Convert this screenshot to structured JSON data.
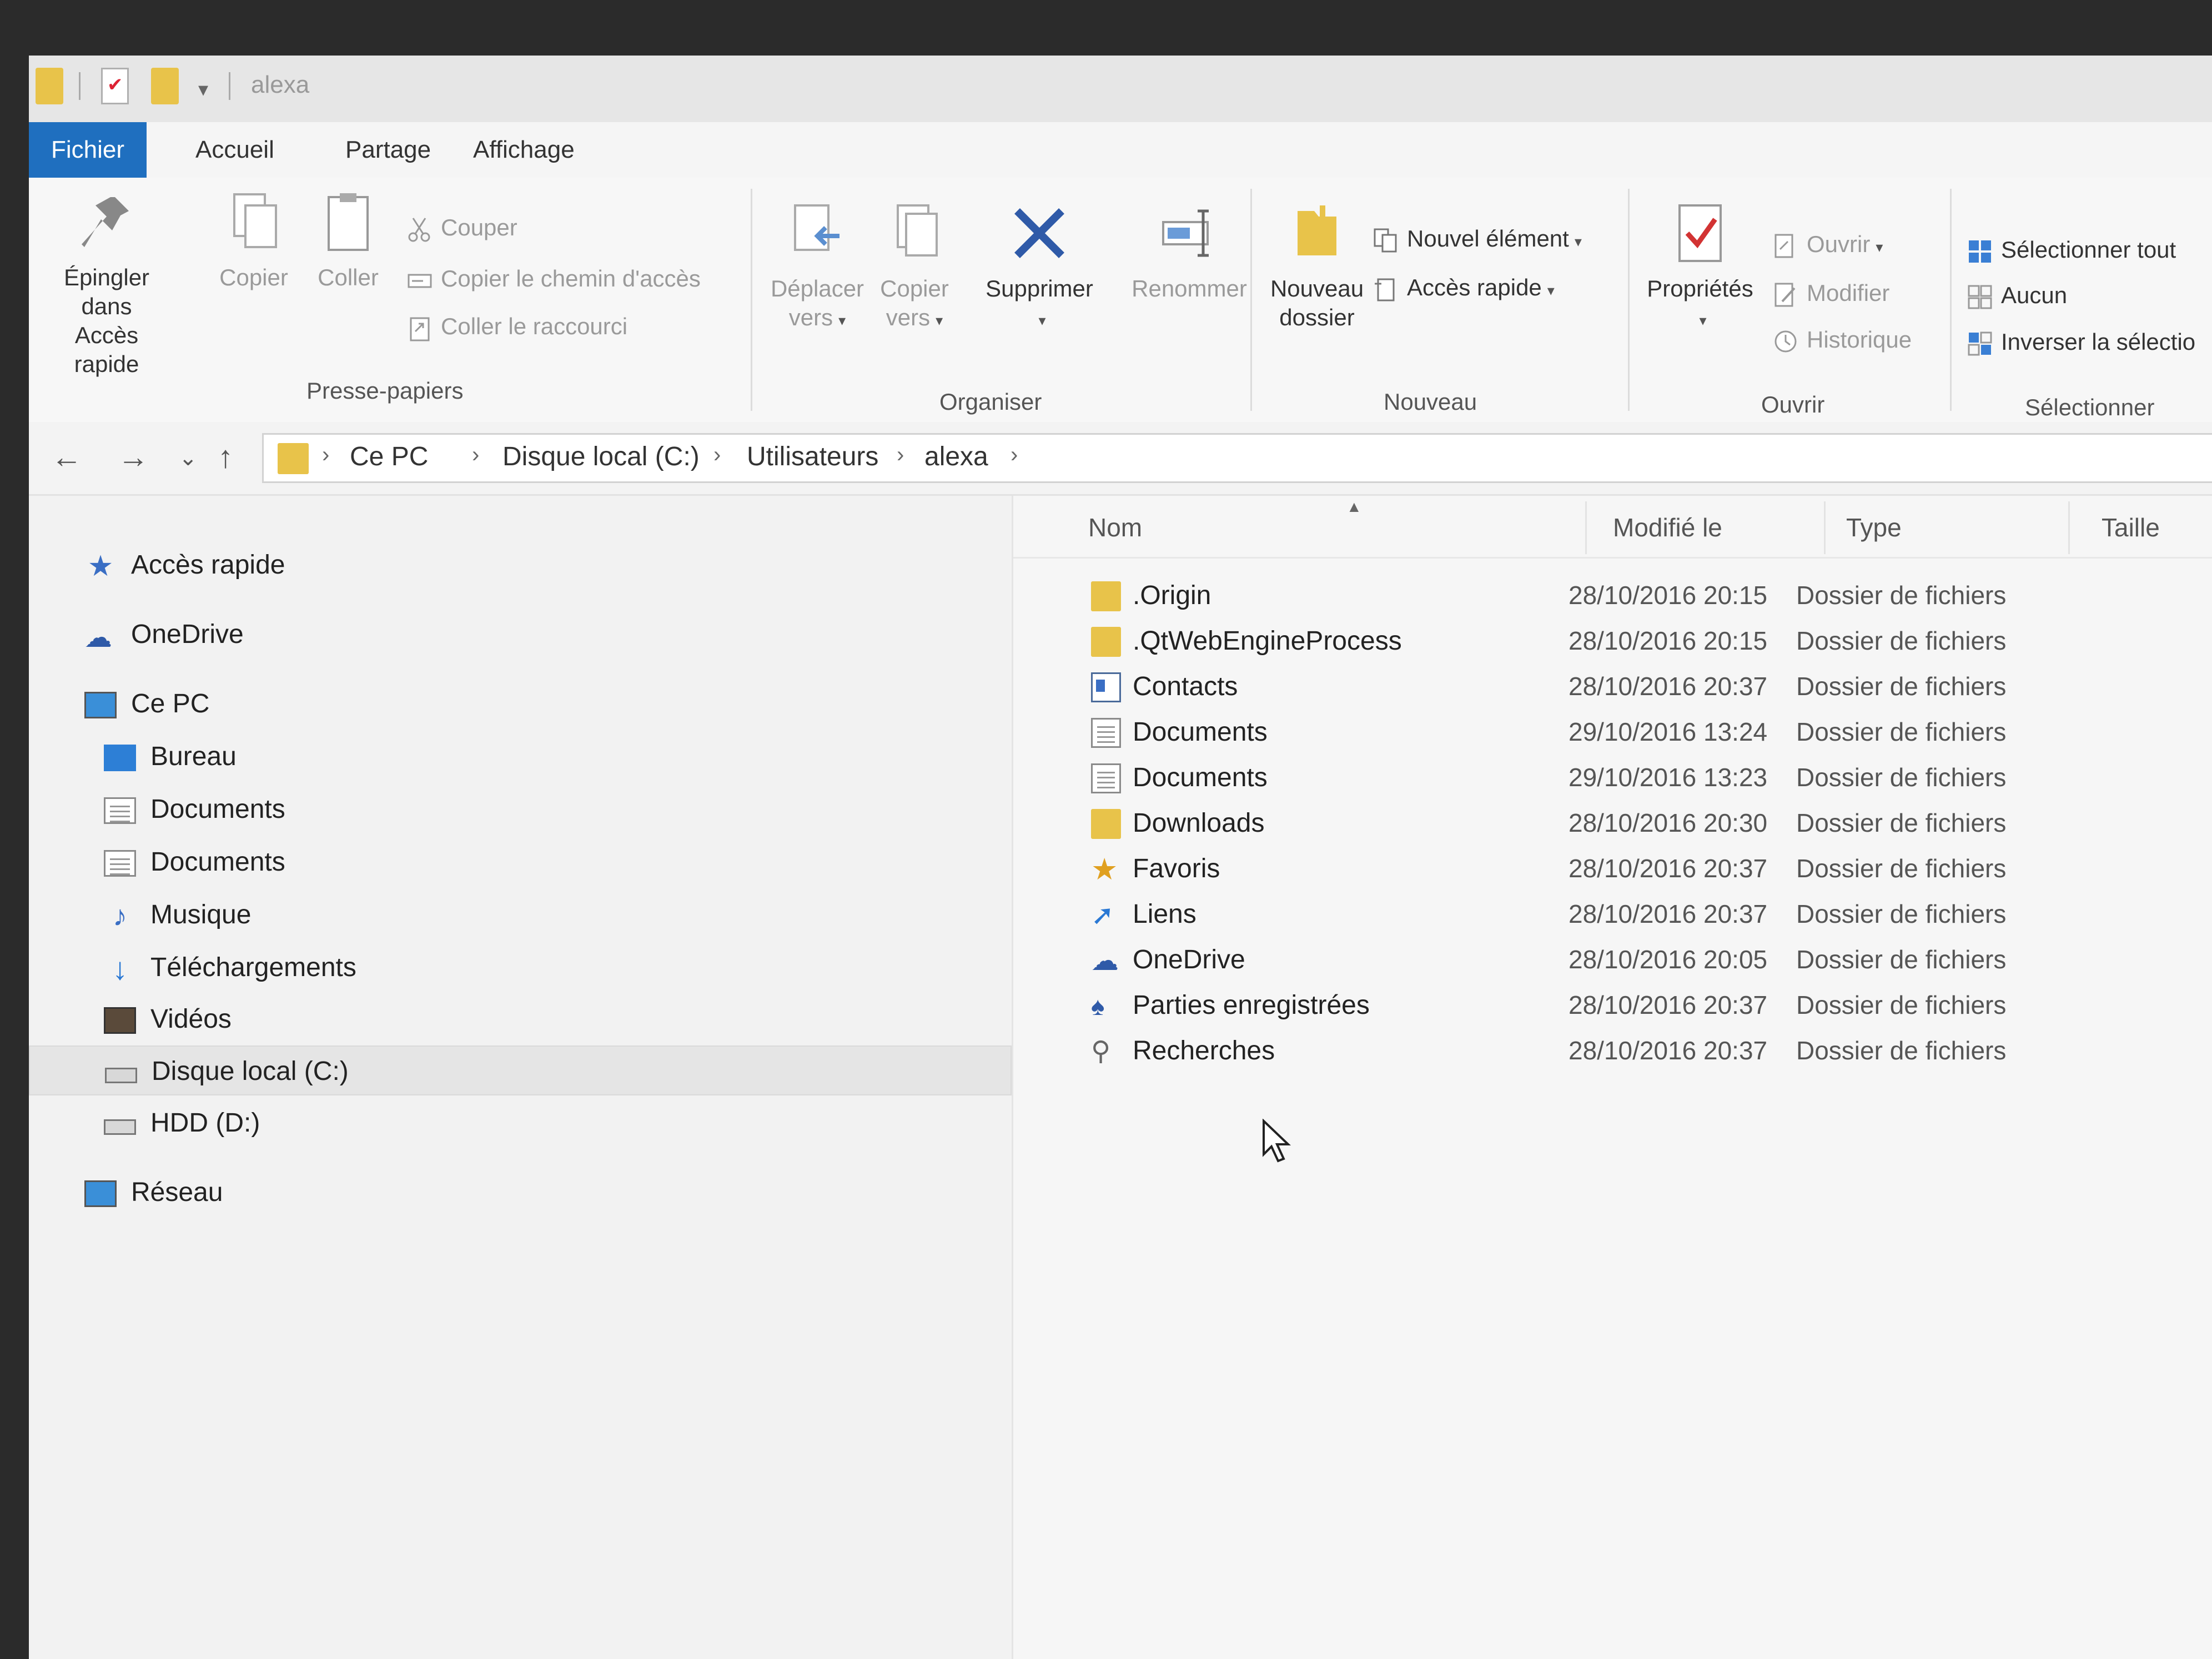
{
  "window": {
    "title": "alexa"
  },
  "ribbon_tabs": [
    {
      "label": "Fichier"
    },
    {
      "label": "Accueil"
    },
    {
      "label": "Partage"
    },
    {
      "label": "Affichage"
    }
  ],
  "ribbon": {
    "clipboard": {
      "pin_label_1": "Épingler dans",
      "pin_label_2": "Accès rapide",
      "copy_label": "Copier",
      "paste_label": "Coller",
      "cut_label": "Couper",
      "copy_path_label": "Copier le chemin d'accès",
      "paste_shortcut_label": "Coller le raccourci",
      "group_label": "Presse-papiers"
    },
    "organize": {
      "move_label_1": "Déplacer",
      "move_label_2": "vers",
      "copyto_label_1": "Copier",
      "copyto_label_2": "vers",
      "delete_label": "Supprimer",
      "rename_label": "Renommer",
      "group_label": "Organiser"
    },
    "new": {
      "new_folder_label_1": "Nouveau",
      "new_folder_label_2": "dossier",
      "new_item_label": "Nouvel élément",
      "easy_access_label": "Accès rapide",
      "group_label": "Nouveau"
    },
    "open": {
      "properties_label": "Propriétés",
      "open_label": "Ouvrir",
      "edit_label": "Modifier",
      "history_label": "Historique",
      "group_label": "Ouvrir"
    },
    "select": {
      "select_all_label": "Sélectionner tout",
      "select_none_label": "Aucun",
      "invert_label": "Inverser la sélectio",
      "group_label": "Sélectionner"
    }
  },
  "address": {
    "crumbs": [
      "Ce PC",
      "Disque local (C:)",
      "Utilisateurs",
      "alexa"
    ]
  },
  "nav": {
    "items": [
      {
        "label": "Accès rapide",
        "icon": "star-icon"
      },
      {
        "label": "OneDrive",
        "icon": "cloud-icon"
      },
      {
        "label": "Ce PC",
        "icon": "computer-icon"
      },
      {
        "label": "Bureau",
        "icon": "desktop-icon"
      },
      {
        "label": "Documents",
        "icon": "documents-icon"
      },
      {
        "label": "Documents",
        "icon": "pictures-icon"
      },
      {
        "label": "Musique",
        "icon": "music-icon"
      },
      {
        "label": "Téléchargements",
        "icon": "download-icon"
      },
      {
        "label": "Vidéos",
        "icon": "video-icon"
      },
      {
        "label": "Disque local (C:)",
        "icon": "drive-icon"
      },
      {
        "label": "HDD (D:)",
        "icon": "drive-icon"
      },
      {
        "label": "Réseau",
        "icon": "network-icon"
      }
    ]
  },
  "filelist": {
    "columns": {
      "name": "Nom",
      "modified": "Modifié le",
      "type": "Type",
      "size": "Taille"
    },
    "rows": [
      {
        "name": ".Origin",
        "modified": "28/10/2016 20:15",
        "type": "Dossier de fichiers",
        "icon": "folder-icon"
      },
      {
        "name": ".QtWebEngineProcess",
        "modified": "28/10/2016 20:15",
        "type": "Dossier de fichiers",
        "icon": "folder-icon"
      },
      {
        "name": "Contacts",
        "modified": "28/10/2016 20:37",
        "type": "Dossier de fichiers",
        "icon": "contacts-icon"
      },
      {
        "name": "Documents",
        "modified": "29/10/2016 13:24",
        "type": "Dossier de fichiers",
        "icon": "documents-icon"
      },
      {
        "name": "Documents",
        "modified": "29/10/2016 13:23",
        "type": "Dossier de fichiers",
        "icon": "documents-icon"
      },
      {
        "name": "Downloads",
        "modified": "28/10/2016 20:30",
        "type": "Dossier de fichiers",
        "icon": "folder-icon"
      },
      {
        "name": "Favoris",
        "modified": "28/10/2016 20:37",
        "type": "Dossier de fichiers",
        "icon": "star-icon"
      },
      {
        "name": "Liens",
        "modified": "28/10/2016 20:37",
        "type": "Dossier de fichiers",
        "icon": "link-icon"
      },
      {
        "name": "OneDrive",
        "modified": "28/10/2016 20:05",
        "type": "Dossier de fichiers",
        "icon": "cloud-icon"
      },
      {
        "name": "Parties enregistrées",
        "modified": "28/10/2016 20:37",
        "type": "Dossier de fichiers",
        "icon": "saved-games-icon"
      },
      {
        "name": "Recherches",
        "modified": "28/10/2016 20:37",
        "type": "Dossier de fichiers",
        "icon": "search-icon"
      }
    ]
  },
  "colors": {
    "file_tab": "#1f6fbf",
    "folder": "#e8c34a",
    "delete_x": "#2f5aa8",
    "properties_check": "#d23333"
  }
}
